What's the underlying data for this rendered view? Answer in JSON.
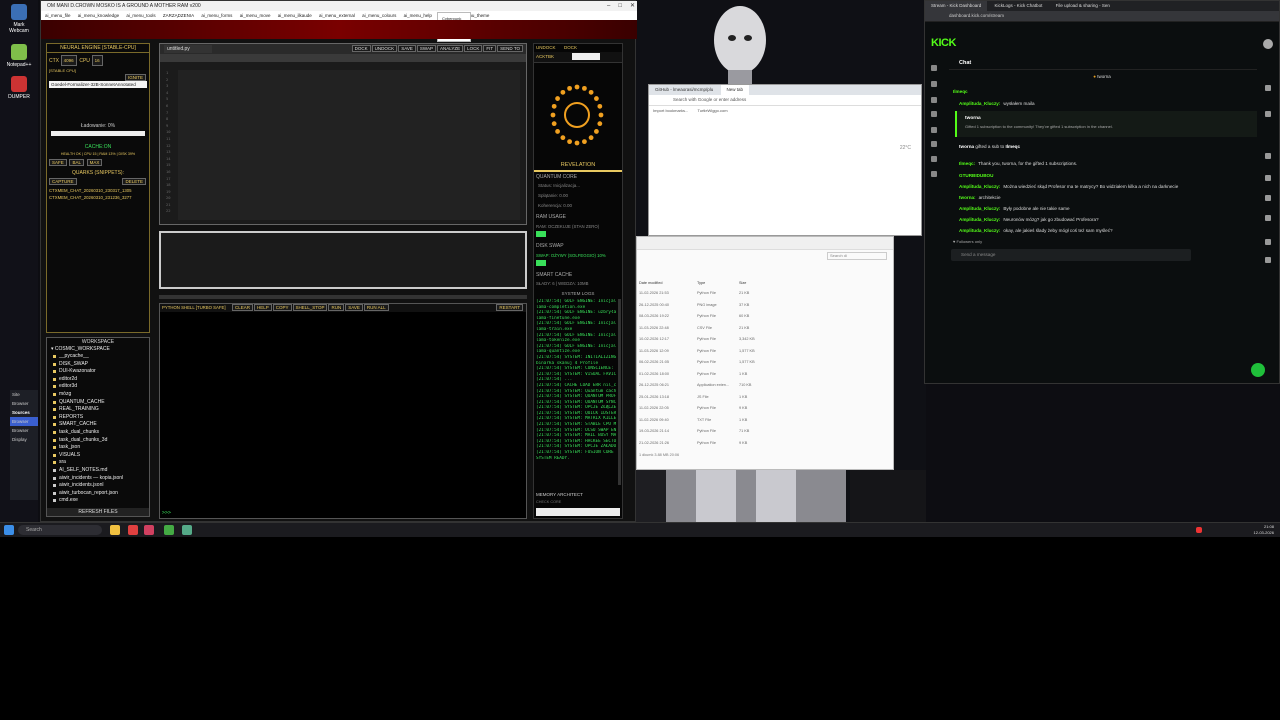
{
  "app": {
    "title": "OM MANI D.CROWN MOSKO IS A GROUND A MOTHER RAM v200",
    "menu": [
      "ai_menu_file",
      "ai_menu_knowledge",
      "ai_menu_tools",
      "ZARZĄDZENIA",
      "ai_menu_forms",
      "ai_menu_move",
      "ai_menu_ilkaude",
      "ai_menu_external",
      "ai_menu_colours",
      "ai_menu_help",
      "TIME",
      "ai_menu_theme"
    ],
    "menu_popup": [
      "Cyberpunk",
      "Matrix",
      "Monolith"
    ],
    "neural": {
      "title": "NEURAL ENGINE [STABLE-CPU]",
      "ctx_label": "CTX",
      "ctx_value": "4096",
      "cpu_label": "CPU",
      "cpu_value": "16",
      "sub": "[STABLE CPU]",
      "ignite": "IGNITE",
      "model": "Goedel-Formalizer-32B-SonnetAnnotated",
      "loading": "Ładowanie: 0%",
      "cache": "CACHE:ON",
      "cache_stats": "HEALTH OK | CPU 15 | RAM 13% | DISK 39%",
      "buttons": [
        "SAFE",
        "BAL",
        "MAX"
      ],
      "quarks": "QUARKS (SNIPPETS):",
      "capture": "CAPTURE",
      "delete": "DELETE",
      "snippets": [
        "CTXMEM_CHAT_20260310_230317_1305",
        "CTXMEM_CHAT_20260310_231236_3277"
      ]
    },
    "editor": {
      "tab": "untitled.py",
      "toolbar": [
        "DOCK",
        "UNDOCK",
        "SAVE",
        "SWAP",
        "ANALYZE",
        "LOCK",
        "FIT",
        "SEND TO"
      ]
    },
    "workspace": {
      "title": "WORKSPACE",
      "root": "COSMIC_WORKSPACE",
      "items": [
        "__pycache__",
        "DISK_SWAP",
        "DUI-Kwazonator",
        "editor2d",
        "editor3d",
        "mózg",
        "QUANTUM_CACHE",
        "REAL_TRAINING",
        "REPORTS",
        "SMART_CACHE",
        "task_dual_chunks",
        "task_dual_chunks_3d",
        "task_json",
        "VISUALS",
        "sra",
        "AI_SELF_NOTES.md",
        "aiwir_incidents — kopia.jsonl",
        "aiwir_incidents.jsonl",
        "aiwir_turbocan_report.json",
        "cmd.exe"
      ],
      "refresh": "REFRESH FILES"
    },
    "shell": {
      "title": "PYTHON SHELL [TURBO SAFE]",
      "buttons": [
        "CLEAR",
        "HELP",
        "COPY",
        "SHELL_STOP",
        "RUN",
        "SAVE",
        "RUN ALL"
      ],
      "restart": "RESTART",
      "prompt": ">>>"
    },
    "right": {
      "undock": "UNDOCK",
      "dock": "DOCK",
      "active_tab": "ACKTBK",
      "revelation": "REVELATION",
      "quantum": "QUANTUM CORE",
      "status": "Status: Inicjalizacja...",
      "spl": "Splątanie: 0.00",
      "koh": "Koherencja: 0.00",
      "ram_title": "RAM USAGE",
      "ram_line": "RAM: OCZEKUJE (STAN ZERO)",
      "disk_title": "DISK SWAP",
      "disk_line": "SWAP: OŻYWY (SOLFEGGIO) 10%",
      "smart_title": "SMART CACHE",
      "smart_line": "SŁADY: 6 | WIEDZA: 10MB",
      "logs_title": "SYSTEM LOGS",
      "logs": [
        "[21:07:54] GOLF ENGINE: Inicjalizacja...",
        "lama-completion.exe",
        "[21:07:54] GOLF ENGINE: uzbryła pl",
        "lama-finetune.exe",
        "[21:07:54] GOLF ENGINE: Inicjalizacja",
        "lama-train.exe",
        "[21:07:54] GOLF ENGINE: Inicjalizacja",
        "lama-tokenize.exe",
        "[21:07:54] GOLF ENGINE: Inicjalizacja",
        "lama-quantize.exe",
        "[21:07:54] SYSTEM: INITIALIZING RLS",
        "binarka skanuj 4 Profile",
        "[21:07:54] SYSTEM: CONSCIENCE: Zest",
        "[21:07:54] SYSTEM: VISUAL FAVICATIO",
        "[21:07:54] ...",
        "[21:07:54] CACHE LOAD ERR nil_comm",
        "[21:07:54] SYSTEM: Quantum cache",
        "[21:07:54] SYSTEM: QUANTUM PROFIT",
        "[21:07:54] SYSTEM: QUANTUM SYNC",
        "[21:07:54] SYSTEM: OPCJE ZŁĄCZENIA",
        "[21:07:54] SYSTEM: QUICK IDSTERBIE",
        "[21:07:54] SYSTEM: MATRIX KILLED",
        "[21:07:54] SYSTEM: STABLE CPU MODE",
        "[21:07:54] SYSTEM: OCSU SWAP ENABL",
        "[21:07:54] SYSTEM: MAIL BUSY MASTER",
        "[21:07:54] SYSTEM: HACKEE SECTOR",
        "[21:07:54] SYSTEM: OPCJE ZAŁADOWANE",
        "[21:07:54] SYSTEM: FUSION CORE",
        "SYSTEM READY."
      ],
      "memory": "MEMORY ARCHITECT",
      "memory_sub": "CHECK CORE"
    }
  },
  "kick": {
    "tabs": [
      "Stream - Kick Dashboard",
      "KickLogs - Kick Chatbot",
      "File upload & sharing - Sen"
    ],
    "url": "dashboard.kick.com/stream",
    "logo": "KICK",
    "chat_title": "Chat",
    "pinned_user": "tworna",
    "gift_title": "tworna",
    "gift_text": "Gifted 1 subscription to the community! They've gifted 1 subscription in the channel.",
    "gifted_line": "gifted a sub to",
    "gifted_target": "Ilmeqc",
    "messages": [
      {
        "user": "Ilmeqc",
        "text": ""
      },
      {
        "user": "Amplituda_Kluczy:",
        "text": "wysłałem maila"
      },
      {
        "user": "tworna",
        "text": ""
      },
      {
        "user": "Ilmeqc:",
        "text": "Thank you, tworna, for the gifted 1 subscriptions."
      },
      {
        "user": "GTURBIDUBOU",
        "text": ""
      },
      {
        "user": "Amplituda_Kluczy:",
        "text": "Można wiedzieć skąd Profesor ma te matrycy? Bo widziałem kilka a nich na darknecie"
      },
      {
        "user": "tworna:",
        "text": "architekcie"
      },
      {
        "user": "Amplituda_Kluczy:",
        "text": "Były podobne ale nie takie same"
      },
      {
        "user": "Amplituda_Kluczy:",
        "text": "Neuronów mózg? jak go zbudować Profesora?"
      },
      {
        "user": "Amplituda_Kluczy:",
        "text": "okay, ale jakieś ślady żeby mógł coś też sam myśleć?"
      }
    ],
    "followers_only": "Followers only",
    "input_placeholder": "Send a message",
    "colors": {
      "brand": "#53fc18",
      "bg": "#0b0e0f"
    }
  },
  "chrome": {
    "tabs": [
      "GitHub - lmeaorasi/mcmp/plu",
      "New tab"
    ],
    "search_placeholder": "Search with Google or enter address",
    "bookmarks": [
      "Import bookmarks...",
      "TurtleWiggo.com"
    ],
    "weather": "22°C"
  },
  "explorer": {
    "search": "Search di",
    "headers": [
      "Date modified",
      "Type",
      "Size"
    ],
    "rows": [
      [
        "11-02-2026 21:53",
        "Python File",
        "21 KB"
      ],
      [
        "26-12-2025 00:40",
        "PNG image",
        "37 KB"
      ],
      [
        "08-03-2026 19:22",
        "Python File",
        "60 KB"
      ],
      [
        "11-03-2026 22:48",
        "CSV File",
        "21 KB"
      ],
      [
        "10-02-2026 12:17",
        "Python File",
        "3,342 KB"
      ],
      [
        "11-03-2026 12:09",
        "Python File",
        "1,577 KB"
      ],
      [
        "06-02-2026 21:05",
        "Python File",
        "1,577 KB"
      ],
      [
        "01-02-2026 18:00",
        "Python File",
        "1 KB"
      ],
      [
        "26-12-2025 06:21",
        "Application exten...",
        "710 KB"
      ],
      [
        "25-01-2026 13:18",
        "JS File",
        "1 KB"
      ],
      [
        "11-02-2026 22:05",
        "Python File",
        "9 KB"
      ],
      [
        "11-02-2026 09:40",
        "TXT File",
        "1 KB"
      ],
      [
        "19-03-2026 21:14",
        "Python File",
        "71 KB"
      ],
      [
        "21-02-2026 21:26",
        "Python File",
        "9 KB"
      ]
    ],
    "status": "1 dkumk      3.88 MB 20:06"
  },
  "desktop": {
    "icons": [
      "Mark Webcam",
      "Notepad++",
      "DUMPER"
    ],
    "sidepanel": [
      "Site",
      "Browser",
      "Sources",
      "Browser",
      "Browser",
      "Display"
    ]
  },
  "taskbar": {
    "search": "Search",
    "time": "21:08",
    "date": "12-03-2026"
  }
}
